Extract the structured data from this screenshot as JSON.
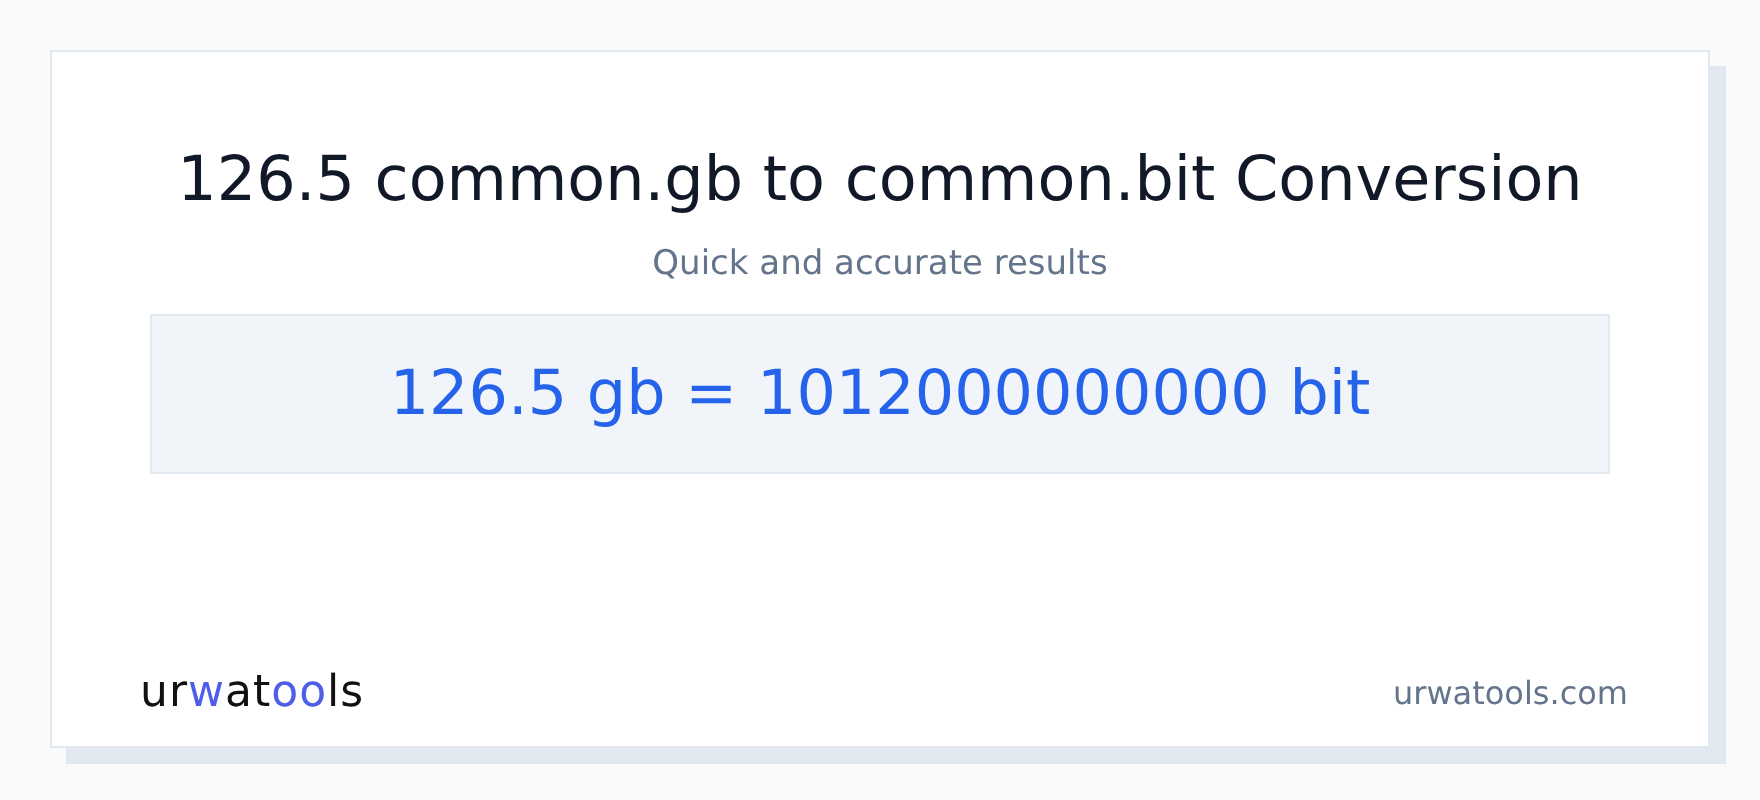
{
  "title": "126.5 common.gb to common.bit Conversion",
  "subtitle": "Quick and accurate results",
  "result": "126.5 gb = 1012000000000 bit",
  "logo": [
    {
      "text": "ur",
      "accent": false
    },
    {
      "text": "w",
      "accent": true
    },
    {
      "text": "at",
      "accent": false
    },
    {
      "text": "oo",
      "accent": true
    },
    {
      "text": "ls",
      "accent": false
    }
  ],
  "site": "urwatools.com"
}
